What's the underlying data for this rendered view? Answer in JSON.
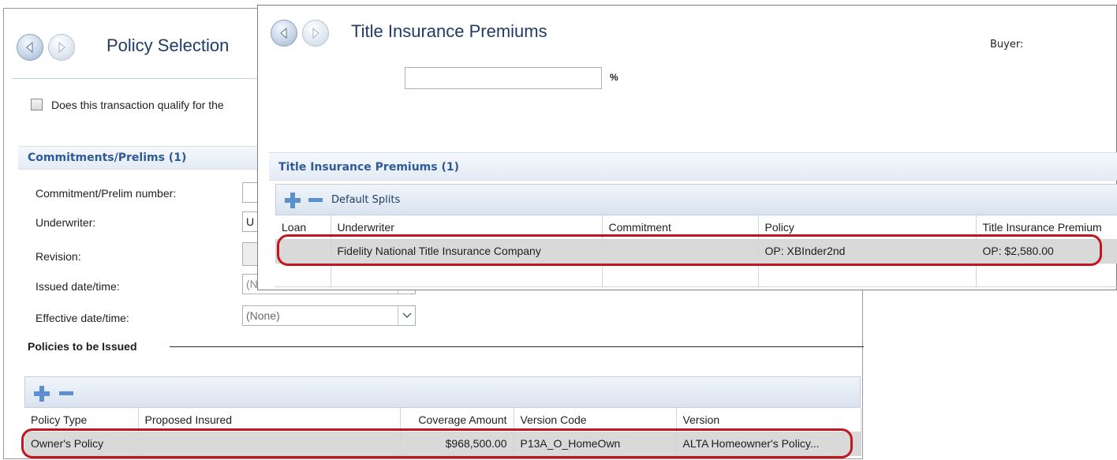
{
  "policy_selection": {
    "title": "Policy Selection",
    "qualify_label": "Does this transaction qualify for the",
    "commitments": {
      "header": "Commitments/Prelims (1)",
      "fields": {
        "commitment_number": "Commitment/Prelim number:",
        "underwriter": "Underwriter:",
        "underwriter_value": "U",
        "revision": "Revision:",
        "issued": "Issued date/time:",
        "issued_value": "(N",
        "effective": "Effective date/time:",
        "effective_value": "(None)"
      }
    },
    "policies_to_be_issued": {
      "header": "Policies to be Issued",
      "columns": [
        "Policy Type",
        "Proposed Insured",
        "Coverage Amount",
        "Version Code",
        "Version"
      ],
      "rows": [
        [
          "Owner's Policy",
          "",
          "$968,500.00",
          "P13A_O_HomeOwn",
          "ALTA Homeowner's Policy..."
        ]
      ]
    }
  },
  "title_premiums": {
    "title": "Title Insurance Premiums",
    "buyer_label": "Buyer:",
    "percent_symbol": "%",
    "section_header": "Title Insurance Premiums (1)",
    "toolbar": {
      "default_splits": "Default Splits"
    },
    "columns": [
      "Loan",
      "Underwriter",
      "Commitment",
      "Policy",
      "Title Insurance Premium"
    ],
    "rows": [
      [
        "",
        "Fidelity National Title Insurance Company",
        "",
        "OP: XBInder2nd",
        "OP: $2,580.00"
      ]
    ]
  },
  "colors": {
    "highlight_ring": "#c0161e",
    "title_text": "#1f3c68",
    "section_text": "#2e5a96"
  }
}
